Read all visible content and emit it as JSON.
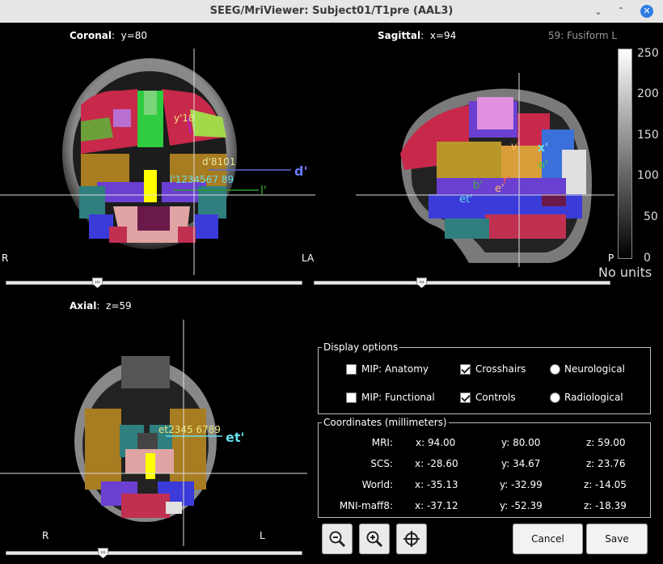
{
  "window": {
    "title": "SEEG/MriViewer: Subject01/T1pre (AAL3)",
    "btn_min": "⌄",
    "btn_restore": "⌃",
    "btn_close": "✕"
  },
  "coronal": {
    "name": "Coronal",
    "coord": "y=80",
    "left": "R",
    "right": "LA",
    "slider": 0.14
  },
  "sagittal": {
    "name": "Sagittal",
    "coord": "x=94",
    "region": "59: Fusiform L",
    "right": "P",
    "slider": 0.36
  },
  "axial": {
    "name": "Axial",
    "coord": "z=59",
    "left": "R",
    "right": "L",
    "slider": 0.33
  },
  "labels": {
    "coronal_y18": "y'18",
    "coronal_d": "d'",
    "coronal_d_contacts": "d'8101",
    "coronal_l": "l'",
    "coronal_l_contacts": "l'1234567 89",
    "sagittal_v": "v'",
    "sagittal_x": "x'",
    "sagittal_o": "o'",
    "sagittal_r": "r'",
    "sagittal_e": "e'",
    "sagittal_b": "b'",
    "sagittal_et": "et'",
    "axial_et": "et'",
    "axial_contacts": "et2345 6789"
  },
  "colorbar": {
    "ticks": [
      "250",
      "200",
      "150",
      "100",
      "50",
      "0"
    ],
    "units": "No units"
  },
  "display_options": {
    "title": "Display options",
    "mip_anatomy": {
      "label": "MIP: Anatomy",
      "checked": false
    },
    "crosshairs": {
      "label": "Crosshairs",
      "checked": true
    },
    "neurological": {
      "label": "Neurological",
      "selected": false
    },
    "mip_functional": {
      "label": "MIP: Functional",
      "checked": false
    },
    "controls": {
      "label": "Controls",
      "checked": true
    },
    "radiological": {
      "label": "Radiological",
      "selected": false
    }
  },
  "coordinates": {
    "title": "Coordinates (millimeters)",
    "rows": [
      {
        "label": "MRI:",
        "x": "x: 94.00",
        "y": "y: 80.00",
        "z": "z: 59.00"
      },
      {
        "label": "SCS:",
        "x": "x: -28.60",
        "y": "y: 34.67",
        "z": "z: 23.76"
      },
      {
        "label": "World:",
        "x": "x: -35.13",
        "y": "y: -32.99",
        "z": "z: -14.05"
      },
      {
        "label": "MNI-maff8:",
        "x": "x: -37.12",
        "y": "y: -52.39",
        "z": "z: -18.39"
      }
    ]
  },
  "buttons": {
    "cancel": "Cancel",
    "save": "Save"
  },
  "icons": {
    "zoom_out": "zoom-out-icon",
    "zoom_in": "zoom-in-icon",
    "center": "crosshair-target-icon"
  }
}
